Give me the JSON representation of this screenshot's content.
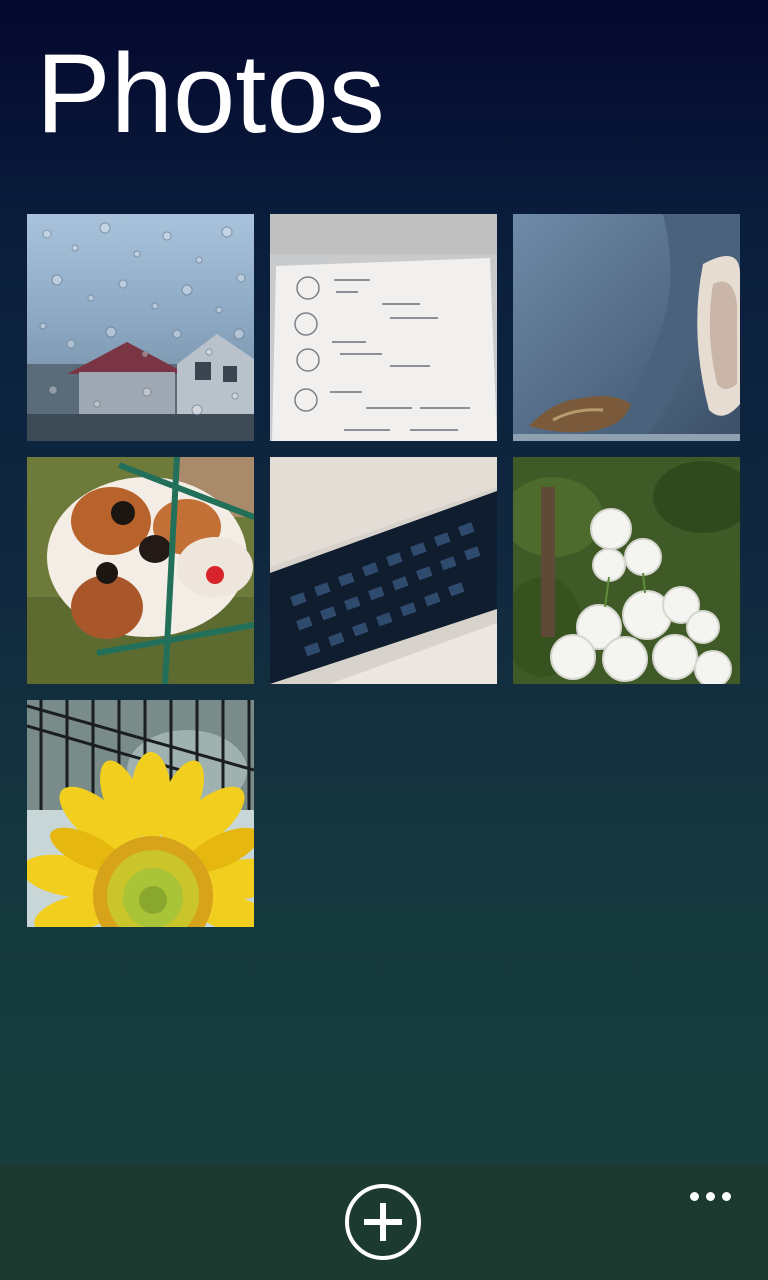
{
  "header": {
    "title": "Photos"
  },
  "photos": [
    {
      "subject": "raindrops-on-window"
    },
    {
      "subject": "paper-document"
    },
    {
      "subject": "blue-fabric"
    },
    {
      "subject": "dog-behind-fence"
    },
    {
      "subject": "keyboard"
    },
    {
      "subject": "white-flowers"
    },
    {
      "subject": "sunflower"
    }
  ],
  "app_bar": {
    "add_icon": "plus-circle-icon",
    "more_icon": "ellipsis-icon"
  },
  "colors": {
    "background_top": "#04072e",
    "background_bottom": "#183f3b",
    "app_bar": "#1d3a31",
    "foreground": "#ffffff"
  }
}
